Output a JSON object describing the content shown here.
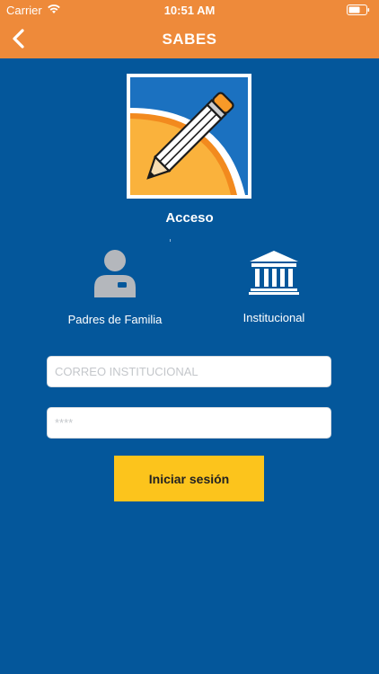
{
  "status_bar": {
    "carrier": "Carrier",
    "time": "10:51 AM"
  },
  "navbar": {
    "title": "SABES"
  },
  "login": {
    "section_title": "Acceso",
    "user_types": [
      {
        "label": "Padres de Familia",
        "icon": "person-icon"
      },
      {
        "label": "Institucional",
        "icon": "institution-icon"
      }
    ],
    "email_placeholder": "CORREO INSTITUCIONAL",
    "password_placeholder": "****",
    "submit_label": "Iniciar sesión"
  },
  "colors": {
    "background": "#04579b",
    "header": "#ee8a3a",
    "button": "#fcc41c",
    "logo_blue": "#1b71c0",
    "logo_orange": "#f89a28"
  }
}
